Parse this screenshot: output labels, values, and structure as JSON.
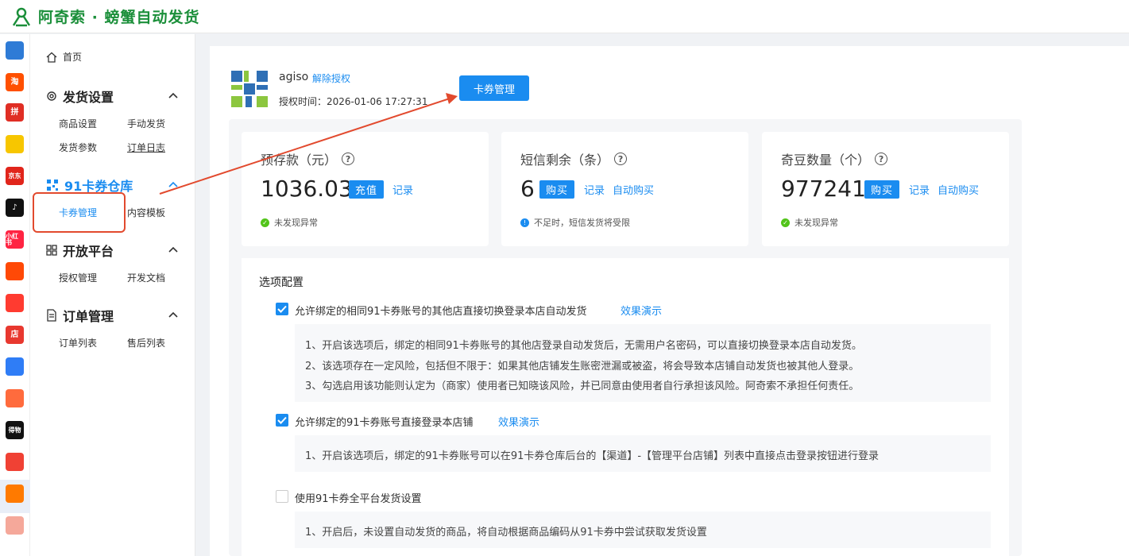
{
  "header": {
    "title": "阿奇索 · 螃蟹自动发货"
  },
  "platform_icons": [
    {
      "name": "qr-platform-icon",
      "label": "",
      "color": "#2e7bd6"
    },
    {
      "name": "taobao-icon",
      "label": "淘",
      "color": "#ff5000"
    },
    {
      "name": "pinduoduo-icon",
      "label": "拼",
      "color": "#e02e24"
    },
    {
      "name": "platform-icon-3",
      "label": "",
      "color": "#f7c600"
    },
    {
      "name": "jd-icon",
      "label": "京东",
      "color": "#e1251b"
    },
    {
      "name": "douyin-icon",
      "label": "♪",
      "color": "#111111"
    },
    {
      "name": "xiaohongshu-icon",
      "label": "小红书",
      "color": "#ff2442"
    },
    {
      "name": "kuaishou-icon",
      "label": "",
      "color": "#ff4906"
    },
    {
      "name": "thumb-icon",
      "label": "",
      "color": "#ff3b30"
    },
    {
      "name": "dian-icon",
      "label": "店",
      "color": "#e8382f"
    },
    {
      "name": "link-platform-icon",
      "label": "",
      "color": "#2f7df6"
    },
    {
      "name": "shop-platform-icon",
      "label": "",
      "color": "#ff6b3d"
    },
    {
      "name": "dewu-icon",
      "label": "得物",
      "color": "#111111"
    },
    {
      "name": "platform-icon-13",
      "label": "",
      "color": "#f04134"
    },
    {
      "name": "crab-icon",
      "label": "",
      "color": "#ff7a00"
    },
    {
      "name": "bag-icon",
      "label": "",
      "color": "#f5a89a"
    }
  ],
  "sidebar": {
    "home": "首页",
    "groups": [
      {
        "title": "发货设置",
        "items": [
          "商品设置",
          "手动发货",
          "发货参数",
          "订单日志"
        ]
      },
      {
        "title": "91卡券仓库",
        "items": [
          "卡券管理",
          "内容模板"
        ]
      },
      {
        "title": "开放平台",
        "items": [
          "授权管理",
          "开发文档"
        ]
      },
      {
        "title": "订单管理",
        "items": [
          "订单列表",
          "售后列表"
        ]
      }
    ]
  },
  "account": {
    "name": "agiso",
    "unauth_link": "解除授权",
    "auth_time": "授权时间：2026-01-06 17:27:31",
    "card_manage_button": "卡券管理"
  },
  "stats": [
    {
      "label": "预存款（元）",
      "value": "1036.03",
      "action": "充值",
      "links": [
        "记录"
      ],
      "status": "未发现异常",
      "status_color": "#52c41a"
    },
    {
      "label": "短信剩余（条）",
      "value": "6",
      "action": "购买",
      "links": [
        "记录",
        "自动购买"
      ],
      "status": "不足时，短信发货将受限",
      "status_color": "#1a8cf0"
    },
    {
      "label": "奇豆数量（个）",
      "value": "977241",
      "action": "购买",
      "links": [
        "记录",
        "自动购买"
      ],
      "status": "未发现异常",
      "status_color": "#52c41a"
    }
  ],
  "options": {
    "title": "选项配置",
    "items": [
      {
        "label": "允许绑定的相同91卡券账号的其他店直接切换登录本店自动发货",
        "checked": true,
        "demo": "效果演示",
        "desc": [
          "1、开启该选项后，绑定的相同91卡券账号的其他店登录自动发货后，无需用户名密码，可以直接切换登录本店自动发货。",
          "2、该选项存在一定风险，包括但不限于：如果其他店铺发生账密泄漏或被盗，将会导致本店铺自动发货也被其他人登录。",
          "3、勾选启用该功能则认定为（商家）使用者已知晓该风险，并已同意由使用者自行承担该风险。阿奇索不承担任何责任。"
        ]
      },
      {
        "label": "允许绑定的91卡券账号直接登录本店铺",
        "checked": true,
        "demo": "效果演示",
        "desc": [
          "1、开启该选项后，绑定的91卡券账号可以在91卡券仓库后台的【渠道】-【管理平台店铺】列表中直接点击登录按钮进行登录"
        ]
      },
      {
        "label": "使用91卡券全平台发货设置",
        "checked": false,
        "demo": "",
        "desc": [
          "1、开启后，未设置自动发货的商品，将自动根据商品编码从91卡券中尝试获取发货设置"
        ]
      }
    ]
  },
  "colors": {
    "accent": "#1a8cf0",
    "brand": "#1b8f3a",
    "annotation": "#e24a2e"
  }
}
